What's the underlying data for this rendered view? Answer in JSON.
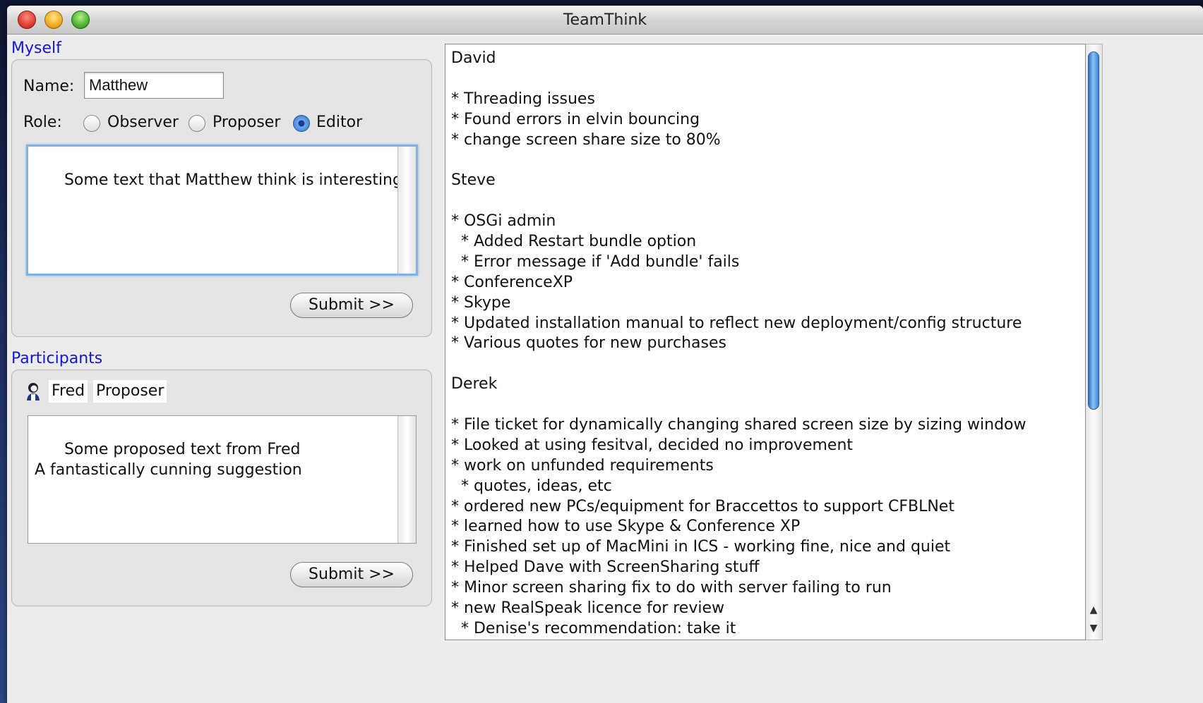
{
  "window": {
    "title": "TeamThink"
  },
  "myself": {
    "section_label": "Myself",
    "name_label": "Name:",
    "name_value": "Matthew",
    "role_label": "Role:",
    "roles": [
      {
        "label": "Observer",
        "selected": false
      },
      {
        "label": "Proposer",
        "selected": false
      },
      {
        "label": "Editor",
        "selected": true
      }
    ],
    "text": "Some text that Matthew think is interesting",
    "submit_label": "Submit >>"
  },
  "participants": {
    "section_label": "Participants",
    "items": [
      {
        "name": "Fred",
        "role": "Proposer",
        "icon": "person-icon",
        "text": "Some proposed text from Fred\nA fantastically cunning suggestion",
        "submit_label": "Submit >>"
      }
    ]
  },
  "log": {
    "lines": [
      "David",
      "",
      "* Threading issues",
      "* Found errors in elvin bouncing",
      "* change screen share size to 80%",
      "",
      "Steve",
      "",
      "* OSGi admin",
      "  * Added Restart bundle option",
      "  * Error message if 'Add bundle' fails",
      "* ConferenceXP",
      "* Skype",
      "* Updated installation manual to reflect new deployment/config structure",
      "* Various quotes for new purchases",
      "",
      "Derek",
      "",
      "* File ticket for dynamically changing shared screen size by sizing window",
      "* Looked at using fesitval, decided no improvement",
      "* work on unfunded requirements",
      "  * quotes, ideas, etc",
      "* ordered new PCs/equipment for Braccettos to support CFBLNet",
      "* learned how to use Skype & Conference XP",
      "* Finished set up of MacMini in ICS - working fine, nice and quiet",
      "* Helped Dave with ScreenSharing stuff",
      "* Minor screen sharing fix to do with server failing to run",
      "* new RealSpeak licence for review",
      "  * Denise's recommendation: take it"
    ]
  }
}
